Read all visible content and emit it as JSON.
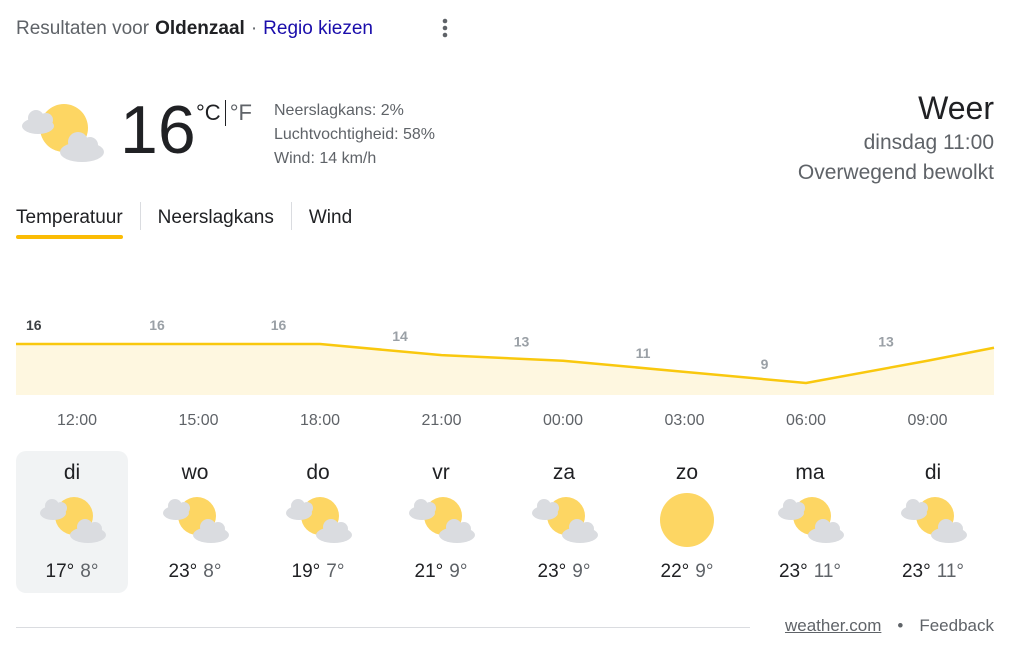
{
  "header": {
    "prefix": "Resultaten voor",
    "location": "Oldenzaal",
    "separator": "·",
    "region_link": "Regio kiezen",
    "menu_icon": "more-vert-icon"
  },
  "current": {
    "icon": "partly-cloudy-icon",
    "temperature": "16",
    "unit_c": "°C",
    "unit_f": "°F",
    "precipitation": "Neerslagkans: 2%",
    "humidity": "Luchtvochtigheid: 58%",
    "wind": "Wind: 14 km/h",
    "title": "Weer",
    "time": "dinsdag 11:00",
    "condition": "Overwegend bewolkt"
  },
  "tabs": [
    "Temperatuur",
    "Neerslagkans",
    "Wind"
  ],
  "active_tab": "Temperatuur",
  "colors": {
    "accent": "#fbbc04",
    "area_fill": "#fef7e0",
    "line": "#f9c80e",
    "sun": "#fdd663",
    "cloud": "#dadce0"
  },
  "chart_data": {
    "type": "area",
    "x": [
      "12:00",
      "15:00",
      "18:00",
      "21:00",
      "00:00",
      "03:00",
      "06:00",
      "09:00"
    ],
    "values": [
      16,
      16,
      16,
      14,
      13,
      11,
      9,
      13
    ],
    "labels": [
      "16",
      "16",
      "16",
      "14",
      "13",
      "11",
      "9",
      "13"
    ],
    "ylabel": "",
    "xlabel": ""
  },
  "days": [
    {
      "name": "di",
      "icon": "partly-cloudy-icon",
      "high": "17°",
      "low": "8°",
      "selected": true
    },
    {
      "name": "wo",
      "icon": "partly-cloudy-icon",
      "high": "23°",
      "low": "8°",
      "selected": false
    },
    {
      "name": "do",
      "icon": "partly-cloudy-icon",
      "high": "19°",
      "low": "7°",
      "selected": false
    },
    {
      "name": "vr",
      "icon": "partly-cloudy-icon",
      "high": "21°",
      "low": "9°",
      "selected": false
    },
    {
      "name": "za",
      "icon": "partly-cloudy-icon",
      "high": "23°",
      "low": "9°",
      "selected": false
    },
    {
      "name": "zo",
      "icon": "sunny-icon",
      "high": "22°",
      "low": "9°",
      "selected": false
    },
    {
      "name": "ma",
      "icon": "partly-cloudy-icon",
      "high": "23°",
      "low": "11°",
      "selected": false
    },
    {
      "name": "di",
      "icon": "partly-cloudy-icon",
      "high": "23°",
      "low": "11°",
      "selected": false
    }
  ],
  "footer": {
    "source": "weather.com",
    "dot": "•",
    "feedback": "Feedback"
  }
}
